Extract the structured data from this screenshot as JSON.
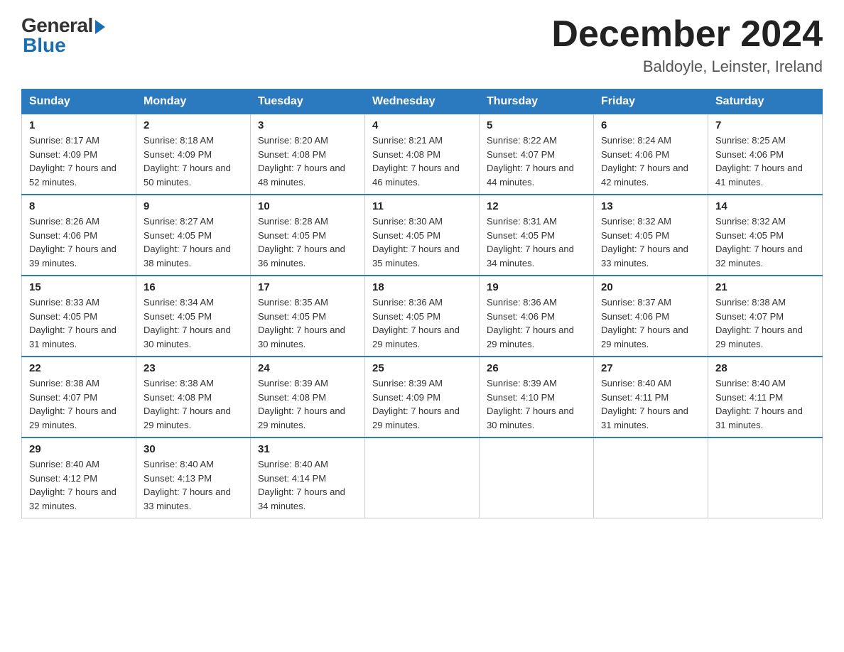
{
  "header": {
    "logo_general": "General",
    "logo_blue": "Blue",
    "month_title": "December 2024",
    "location": "Baldoyle, Leinster, Ireland"
  },
  "days_of_week": [
    "Sunday",
    "Monday",
    "Tuesday",
    "Wednesday",
    "Thursday",
    "Friday",
    "Saturday"
  ],
  "weeks": [
    [
      {
        "day": "1",
        "sunrise": "8:17 AM",
        "sunset": "4:09 PM",
        "daylight": "7 hours and 52 minutes."
      },
      {
        "day": "2",
        "sunrise": "8:18 AM",
        "sunset": "4:09 PM",
        "daylight": "7 hours and 50 minutes."
      },
      {
        "day": "3",
        "sunrise": "8:20 AM",
        "sunset": "4:08 PM",
        "daylight": "7 hours and 48 minutes."
      },
      {
        "day": "4",
        "sunrise": "8:21 AM",
        "sunset": "4:08 PM",
        "daylight": "7 hours and 46 minutes."
      },
      {
        "day": "5",
        "sunrise": "8:22 AM",
        "sunset": "4:07 PM",
        "daylight": "7 hours and 44 minutes."
      },
      {
        "day": "6",
        "sunrise": "8:24 AM",
        "sunset": "4:06 PM",
        "daylight": "7 hours and 42 minutes."
      },
      {
        "day": "7",
        "sunrise": "8:25 AM",
        "sunset": "4:06 PM",
        "daylight": "7 hours and 41 minutes."
      }
    ],
    [
      {
        "day": "8",
        "sunrise": "8:26 AM",
        "sunset": "4:06 PM",
        "daylight": "7 hours and 39 minutes."
      },
      {
        "day": "9",
        "sunrise": "8:27 AM",
        "sunset": "4:05 PM",
        "daylight": "7 hours and 38 minutes."
      },
      {
        "day": "10",
        "sunrise": "8:28 AM",
        "sunset": "4:05 PM",
        "daylight": "7 hours and 36 minutes."
      },
      {
        "day": "11",
        "sunrise": "8:30 AM",
        "sunset": "4:05 PM",
        "daylight": "7 hours and 35 minutes."
      },
      {
        "day": "12",
        "sunrise": "8:31 AM",
        "sunset": "4:05 PM",
        "daylight": "7 hours and 34 minutes."
      },
      {
        "day": "13",
        "sunrise": "8:32 AM",
        "sunset": "4:05 PM",
        "daylight": "7 hours and 33 minutes."
      },
      {
        "day": "14",
        "sunrise": "8:32 AM",
        "sunset": "4:05 PM",
        "daylight": "7 hours and 32 minutes."
      }
    ],
    [
      {
        "day": "15",
        "sunrise": "8:33 AM",
        "sunset": "4:05 PM",
        "daylight": "7 hours and 31 minutes."
      },
      {
        "day": "16",
        "sunrise": "8:34 AM",
        "sunset": "4:05 PM",
        "daylight": "7 hours and 30 minutes."
      },
      {
        "day": "17",
        "sunrise": "8:35 AM",
        "sunset": "4:05 PM",
        "daylight": "7 hours and 30 minutes."
      },
      {
        "day": "18",
        "sunrise": "8:36 AM",
        "sunset": "4:05 PM",
        "daylight": "7 hours and 29 minutes."
      },
      {
        "day": "19",
        "sunrise": "8:36 AM",
        "sunset": "4:06 PM",
        "daylight": "7 hours and 29 minutes."
      },
      {
        "day": "20",
        "sunrise": "8:37 AM",
        "sunset": "4:06 PM",
        "daylight": "7 hours and 29 minutes."
      },
      {
        "day": "21",
        "sunrise": "8:38 AM",
        "sunset": "4:07 PM",
        "daylight": "7 hours and 29 minutes."
      }
    ],
    [
      {
        "day": "22",
        "sunrise": "8:38 AM",
        "sunset": "4:07 PM",
        "daylight": "7 hours and 29 minutes."
      },
      {
        "day": "23",
        "sunrise": "8:38 AM",
        "sunset": "4:08 PM",
        "daylight": "7 hours and 29 minutes."
      },
      {
        "day": "24",
        "sunrise": "8:39 AM",
        "sunset": "4:08 PM",
        "daylight": "7 hours and 29 minutes."
      },
      {
        "day": "25",
        "sunrise": "8:39 AM",
        "sunset": "4:09 PM",
        "daylight": "7 hours and 29 minutes."
      },
      {
        "day": "26",
        "sunrise": "8:39 AM",
        "sunset": "4:10 PM",
        "daylight": "7 hours and 30 minutes."
      },
      {
        "day": "27",
        "sunrise": "8:40 AM",
        "sunset": "4:11 PM",
        "daylight": "7 hours and 31 minutes."
      },
      {
        "day": "28",
        "sunrise": "8:40 AM",
        "sunset": "4:11 PM",
        "daylight": "7 hours and 31 minutes."
      }
    ],
    [
      {
        "day": "29",
        "sunrise": "8:40 AM",
        "sunset": "4:12 PM",
        "daylight": "7 hours and 32 minutes."
      },
      {
        "day": "30",
        "sunrise": "8:40 AM",
        "sunset": "4:13 PM",
        "daylight": "7 hours and 33 minutes."
      },
      {
        "day": "31",
        "sunrise": "8:40 AM",
        "sunset": "4:14 PM",
        "daylight": "7 hours and 34 minutes."
      },
      null,
      null,
      null,
      null
    ]
  ]
}
